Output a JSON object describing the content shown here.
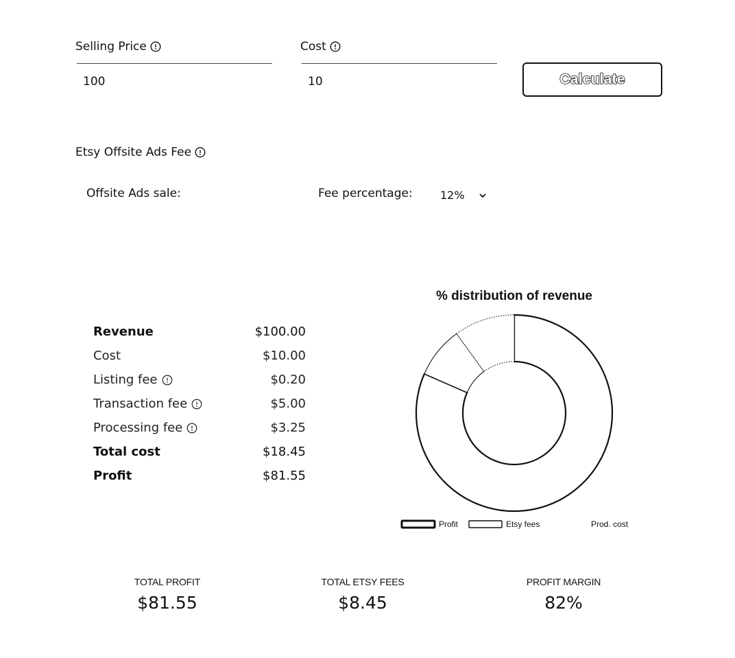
{
  "inputs": {
    "selling_price": {
      "label": "Selling Price",
      "value": "100"
    },
    "cost": {
      "label": "Cost",
      "value": "10"
    },
    "calculate_label": "Calculate"
  },
  "offsite_ads": {
    "section_label": "Etsy Offsite Ads Fee",
    "sale_label": "Offsite Ads sale:",
    "fee_label": "Fee percentage:",
    "fee_value": "12%"
  },
  "breakdown": {
    "revenue": {
      "label": "Revenue",
      "value": "$100.00"
    },
    "cost": {
      "label": "Cost",
      "value": "$10.00"
    },
    "listing_fee": {
      "label": "Listing fee",
      "value": "$0.20"
    },
    "transaction_fee": {
      "label": "Transaction fee",
      "value": "$5.00"
    },
    "processing_fee": {
      "label": "Processing fee",
      "value": "$3.25"
    },
    "total_cost": {
      "label": "Total cost",
      "value": "$18.45"
    },
    "profit": {
      "label": "Profit",
      "value": "$81.55"
    }
  },
  "chart_data": {
    "type": "pie",
    "title": "% distribution of revenue",
    "categories": [
      "Profit",
      "Etsy fees",
      "Prod. cost"
    ],
    "values": [
      81.55,
      8.45,
      10
    ],
    "legend_position": "bottom"
  },
  "summary": {
    "total_profit": {
      "label": "TOTAL PROFIT",
      "value": "$81.55"
    },
    "total_etsy_fees": {
      "label": "TOTAL ETSY FEES",
      "value": "$8.45"
    },
    "profit_margin": {
      "label": "PROFIT MARGIN",
      "value": "82%"
    }
  },
  "icons": {
    "info": "info-circle-icon",
    "dropdown": "chevron-down-icon"
  },
  "colors": {
    "text": "#111111",
    "background": "#ffffff"
  }
}
